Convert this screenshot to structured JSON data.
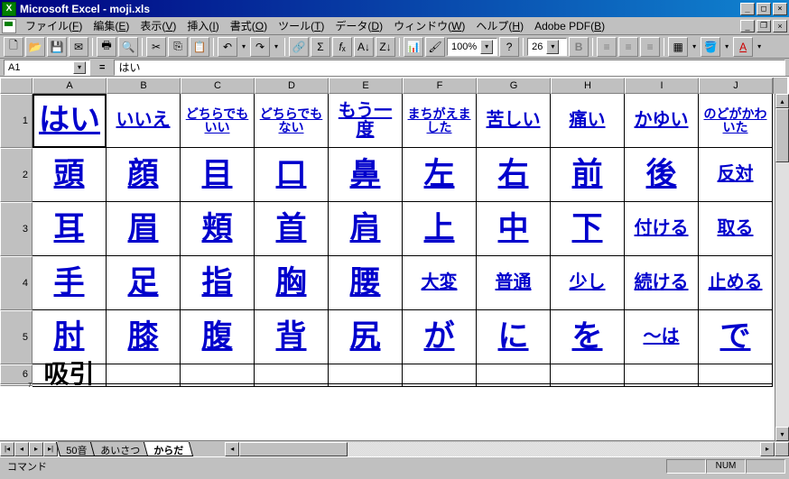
{
  "title": "Microsoft Excel - moji.xls",
  "menus": [
    "ファイル(F)",
    "編集(E)",
    "表示(V)",
    "挿入(I)",
    "書式(O)",
    "ツール(T)",
    "データ(D)",
    "ウィンドウ(W)",
    "ヘルプ(H)",
    "Adobe PDF(B)"
  ],
  "zoom": "100%",
  "fontsize": "26",
  "namebox": "A1",
  "formula": "はい",
  "columns": [
    "A",
    "B",
    "C",
    "D",
    "E",
    "F",
    "G",
    "H",
    "I",
    "J"
  ],
  "rows": [
    "1",
    "2",
    "3",
    "4",
    "5",
    "6",
    "7"
  ],
  "cells": {
    "r1": [
      {
        "t": "はい",
        "sz": "tall"
      },
      {
        "t": "いいえ",
        "sz": "med"
      },
      {
        "t": "どちらでもいい",
        "sz": "sm"
      },
      {
        "t": "どちらでもない",
        "sz": "sm"
      },
      {
        "t": "もう一度",
        "sz": "med"
      },
      {
        "t": "まちがえました",
        "sz": "sm"
      },
      {
        "t": "苦しい",
        "sz": "med"
      },
      {
        "t": "痛い",
        "sz": "med"
      },
      {
        "t": "かゆい",
        "sz": "med"
      },
      {
        "t": "のどがかわいた",
        "sz": "sm"
      }
    ],
    "r2": [
      {
        "t": "頭"
      },
      {
        "t": "顔"
      },
      {
        "t": "目"
      },
      {
        "t": "口"
      },
      {
        "t": "鼻"
      },
      {
        "t": "左"
      },
      {
        "t": "右"
      },
      {
        "t": "前"
      },
      {
        "t": "後"
      },
      {
        "t": "反対",
        "sz": "med"
      }
    ],
    "r3": [
      {
        "t": "耳"
      },
      {
        "t": "眉"
      },
      {
        "t": "頬"
      },
      {
        "t": "首"
      },
      {
        "t": "肩"
      },
      {
        "t": "上"
      },
      {
        "t": "中"
      },
      {
        "t": "下"
      },
      {
        "t": "付ける",
        "sz": "med"
      },
      {
        "t": "取る",
        "sz": "med"
      }
    ],
    "r4": [
      {
        "t": "手"
      },
      {
        "t": "足"
      },
      {
        "t": "指"
      },
      {
        "t": "胸"
      },
      {
        "t": "腰"
      },
      {
        "t": "大変",
        "sz": "med"
      },
      {
        "t": "普通",
        "sz": "med"
      },
      {
        "t": "少し",
        "sz": "med"
      },
      {
        "t": "続ける",
        "sz": "med"
      },
      {
        "t": "止める",
        "sz": "med"
      }
    ],
    "r5": [
      {
        "t": "肘"
      },
      {
        "t": "膝"
      },
      {
        "t": "腹"
      },
      {
        "t": "背"
      },
      {
        "t": "尻"
      },
      {
        "t": "が"
      },
      {
        "t": "に"
      },
      {
        "t": "を"
      },
      {
        "t": "～は",
        "sz": "med"
      },
      {
        "t": "で"
      }
    ],
    "r6": [
      {
        "t": "吸引",
        "plain": true
      },
      {
        "t": ""
      },
      {
        "t": ""
      },
      {
        "t": ""
      },
      {
        "t": ""
      },
      {
        "t": ""
      },
      {
        "t": ""
      },
      {
        "t": ""
      },
      {
        "t": ""
      },
      {
        "t": ""
      }
    ]
  },
  "sheets": [
    "50音",
    "あいさつ",
    "からだ"
  ],
  "activeSheet": 2,
  "status": "コマンド",
  "indicators": [
    "",
    "NUM",
    ""
  ]
}
